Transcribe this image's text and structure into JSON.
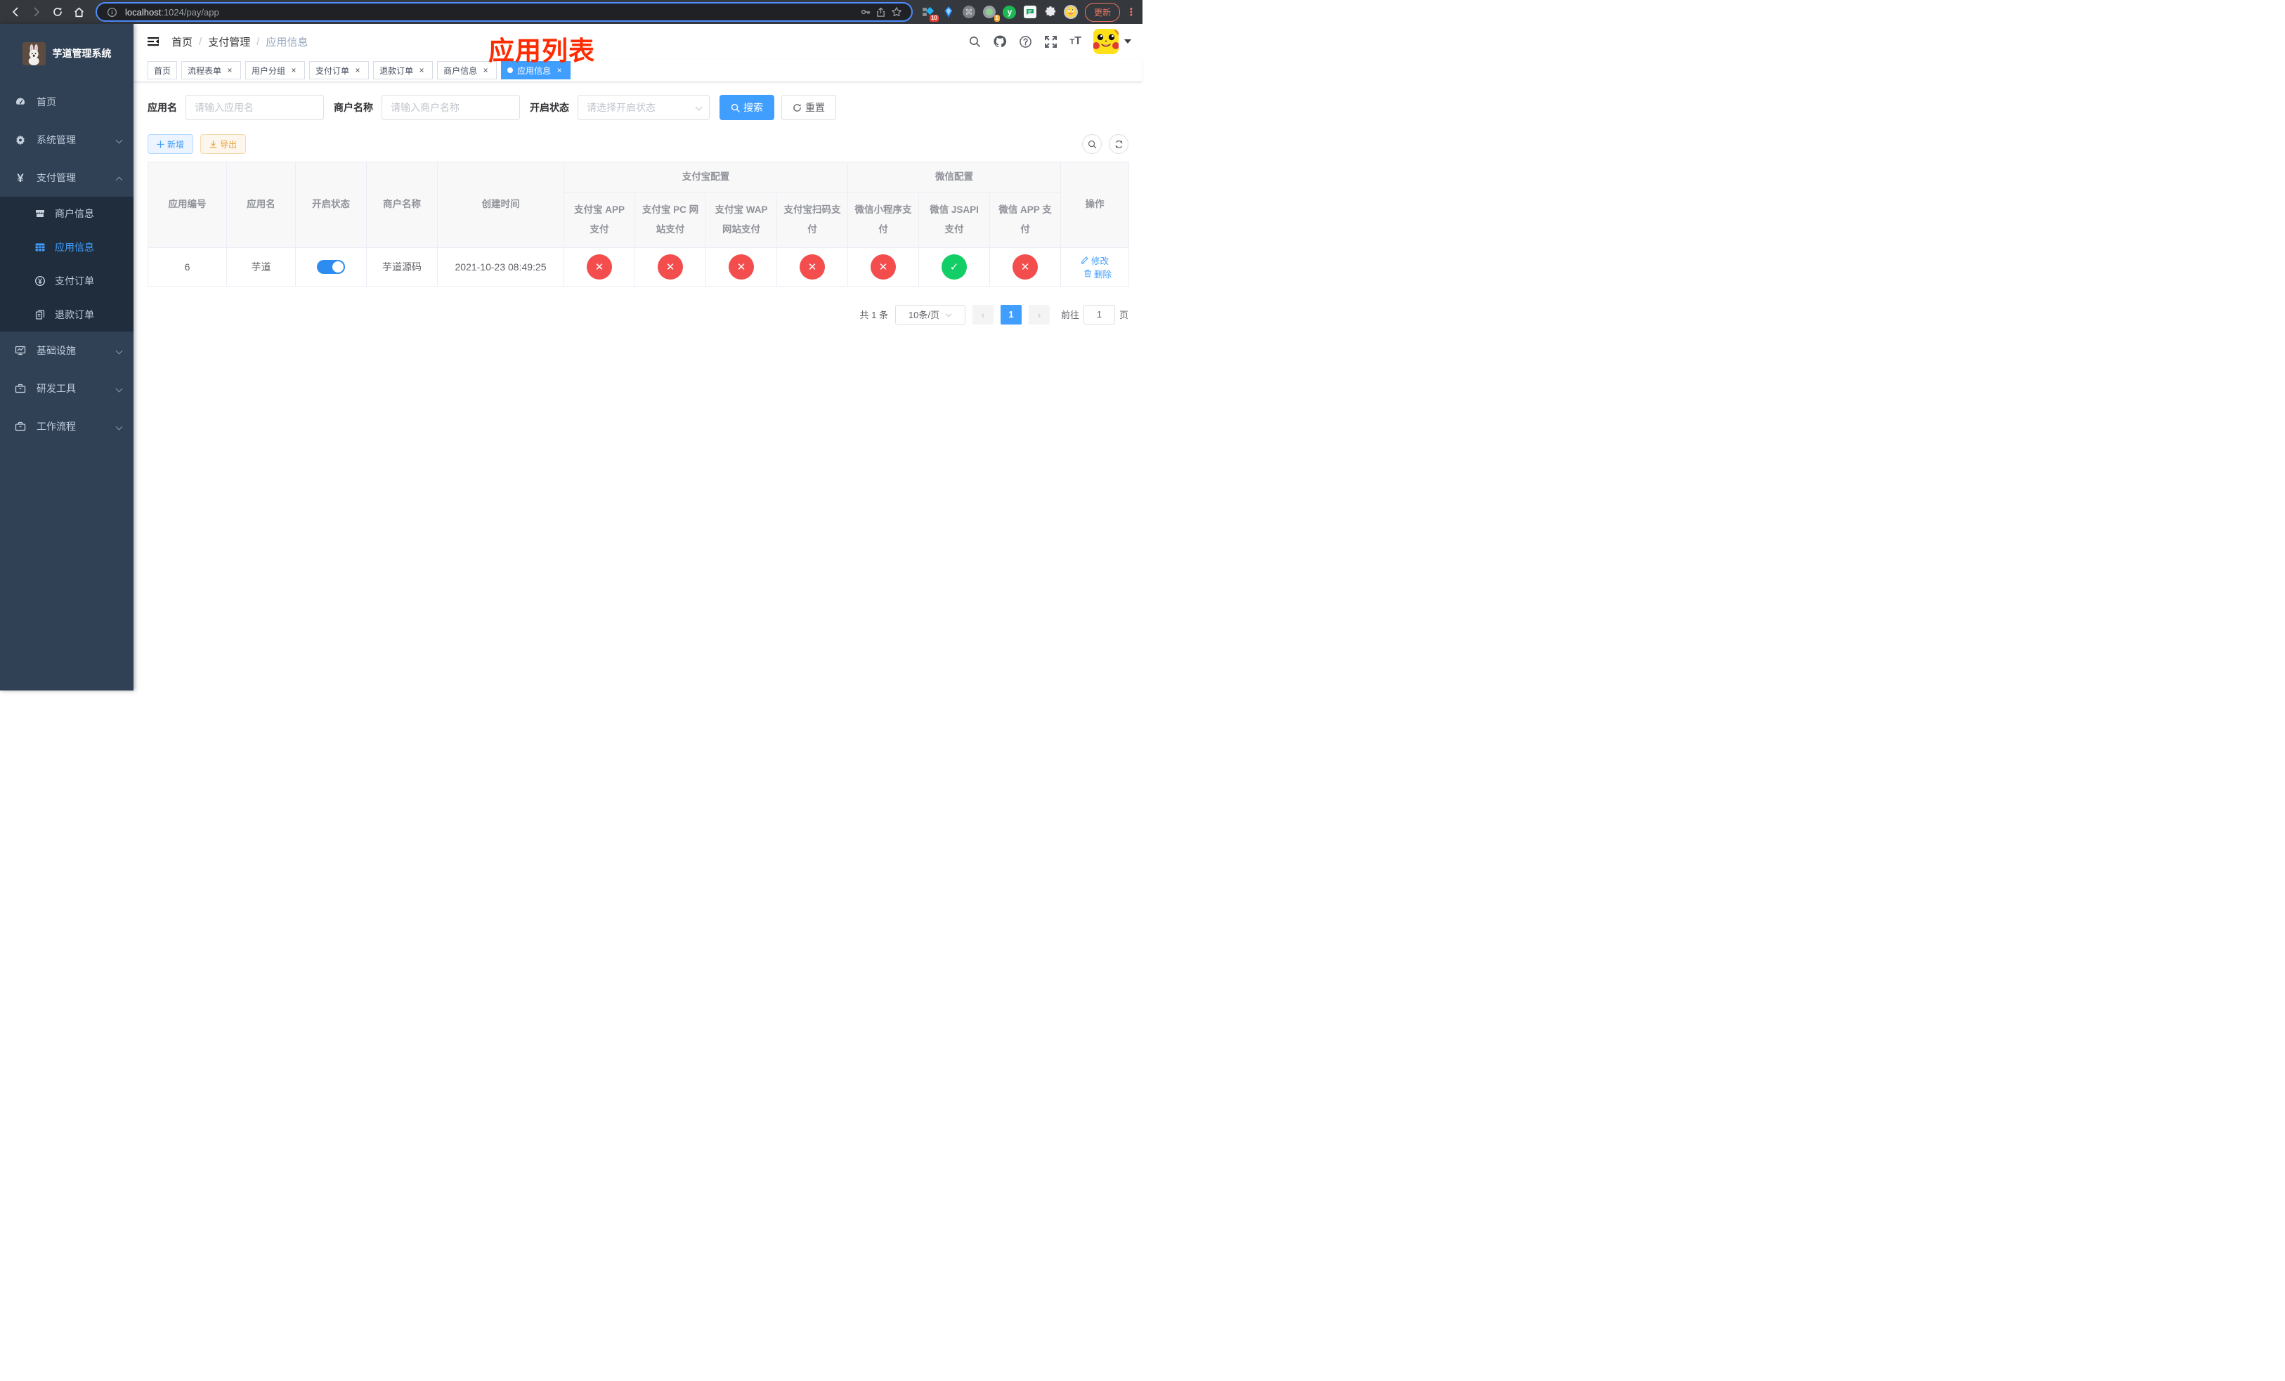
{
  "browser": {
    "url_host": "localhost",
    "url_path": ":1024/pay/app",
    "update_label": "更新",
    "ext_badge_blocker": "10",
    "ext_badge_session": "1",
    "ext_y_letter": "y"
  },
  "annotation": {
    "text": "应用列表",
    "color": "#ff2b00"
  },
  "sidebar": {
    "title": "芋道管理系统",
    "home": "首页",
    "system": "系统管理",
    "pay": "支付管理",
    "merchant": "商户信息",
    "app_info": "应用信息",
    "pay_order": "支付订单",
    "refund_order": "退款订单",
    "infra": "基础设施",
    "dev_tools": "研发工具",
    "workflow": "工作流程"
  },
  "breadcrumb": {
    "b1": "首页",
    "b2": "支付管理",
    "b3": "应用信息"
  },
  "tabs": {
    "home": "首页",
    "flow_form": "流程表单",
    "user_group": "用户分组",
    "pay_order": "支付订单",
    "refund_order": "退款订单",
    "merchant": "商户信息",
    "app_info": "应用信息"
  },
  "filters": {
    "app_name_label": "应用名",
    "app_name_placeholder": "请输入应用名",
    "merchant_label": "商户名称",
    "merchant_placeholder": "请输入商户名称",
    "status_label": "开启状态",
    "status_placeholder": "请选择开启状态",
    "search_label": "搜索",
    "reset_label": "重置"
  },
  "toolbar": {
    "add_label": "新增",
    "export_label": "导出"
  },
  "table": {
    "headers": {
      "app_id": "应用编号",
      "app_name": "应用名",
      "status": "开启状态",
      "merchant": "商户名称",
      "created": "创建时间",
      "alipay_group": "支付宝配置",
      "wechat_group": "微信配置",
      "alipay_app": "支付宝 APP 支付",
      "alipay_pc": "支付宝 PC 网站支付",
      "alipay_wap": "支付宝 WAP 网站支付",
      "alipay_qr": "支付宝扫码支付",
      "wx_mini": "微信小程序支付",
      "wx_jsapi": "微信 JSAPI 支付",
      "wx_app": "微信 APP 支付",
      "actions": "操作"
    },
    "row": {
      "id": "6",
      "name": "芋道",
      "enabled": true,
      "merchant": "芋道源码",
      "created": "2021-10-23 08:49:25",
      "statuses": [
        false,
        false,
        false,
        false,
        false,
        true,
        false
      ]
    },
    "actions": {
      "edit": "修改",
      "delete": "删除"
    }
  },
  "pagination": {
    "total": "共 1 条",
    "page_size": "10条/页",
    "page": "1",
    "goto_label": "前往",
    "goto_value": "1",
    "page_unit": "页"
  },
  "colors": {
    "accent": "#409eff",
    "status_on": "#13ce66",
    "status_off": "#f34d4d",
    "warning": "#e6a23c",
    "sidebar_bg": "#304156",
    "submenu_bg": "#1f2d3d",
    "browser_update": "#ec7764",
    "url_focus_ring": "#4d8dff"
  }
}
